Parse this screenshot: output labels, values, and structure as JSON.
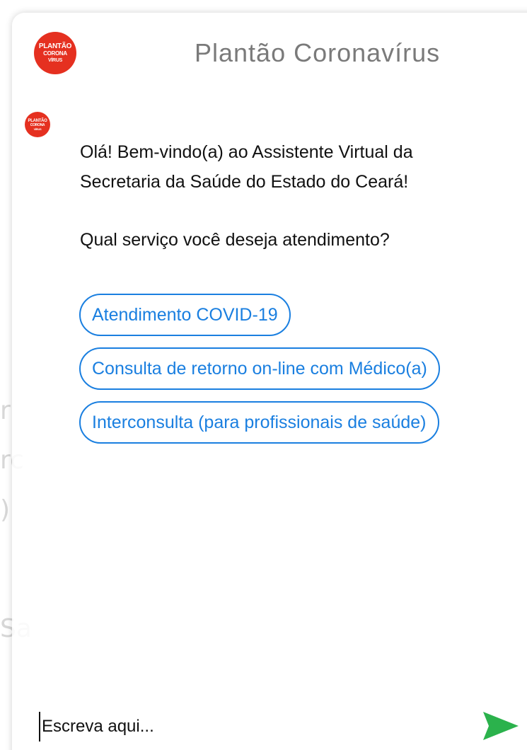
{
  "background_page": {
    "fragments": [
      "r",
      "rc",
      ")",
      "Sa"
    ]
  },
  "chat": {
    "header": {
      "title": "Plantão Coronavírus",
      "logo_text": [
        "PLANTÃO",
        "CORONA",
        "VÍRUS"
      ]
    },
    "bot_message": {
      "greeting_line1": "Olá! Bem-vindo(a) ao Assistente Virtual da",
      "greeting_line2": "Secretaria da Saúde do Estado do Ceará!",
      "question": "Qual serviço você deseja atendimento?"
    },
    "options": [
      {
        "label": "Atendimento COVID-19"
      },
      {
        "label": "Consulta de retorno on-line com Médico(a)"
      },
      {
        "label": "Interconsulta (para profissionais de saúde)"
      }
    ],
    "input": {
      "placeholder": "Escreva aqui...",
      "value": ""
    },
    "send_icon": "send-arrow-icon"
  },
  "colors": {
    "accent_blue": "#1a7fe0",
    "logo_red": "#e53020",
    "send_green": "#2bb24c",
    "title_gray": "#7a7a7a"
  }
}
